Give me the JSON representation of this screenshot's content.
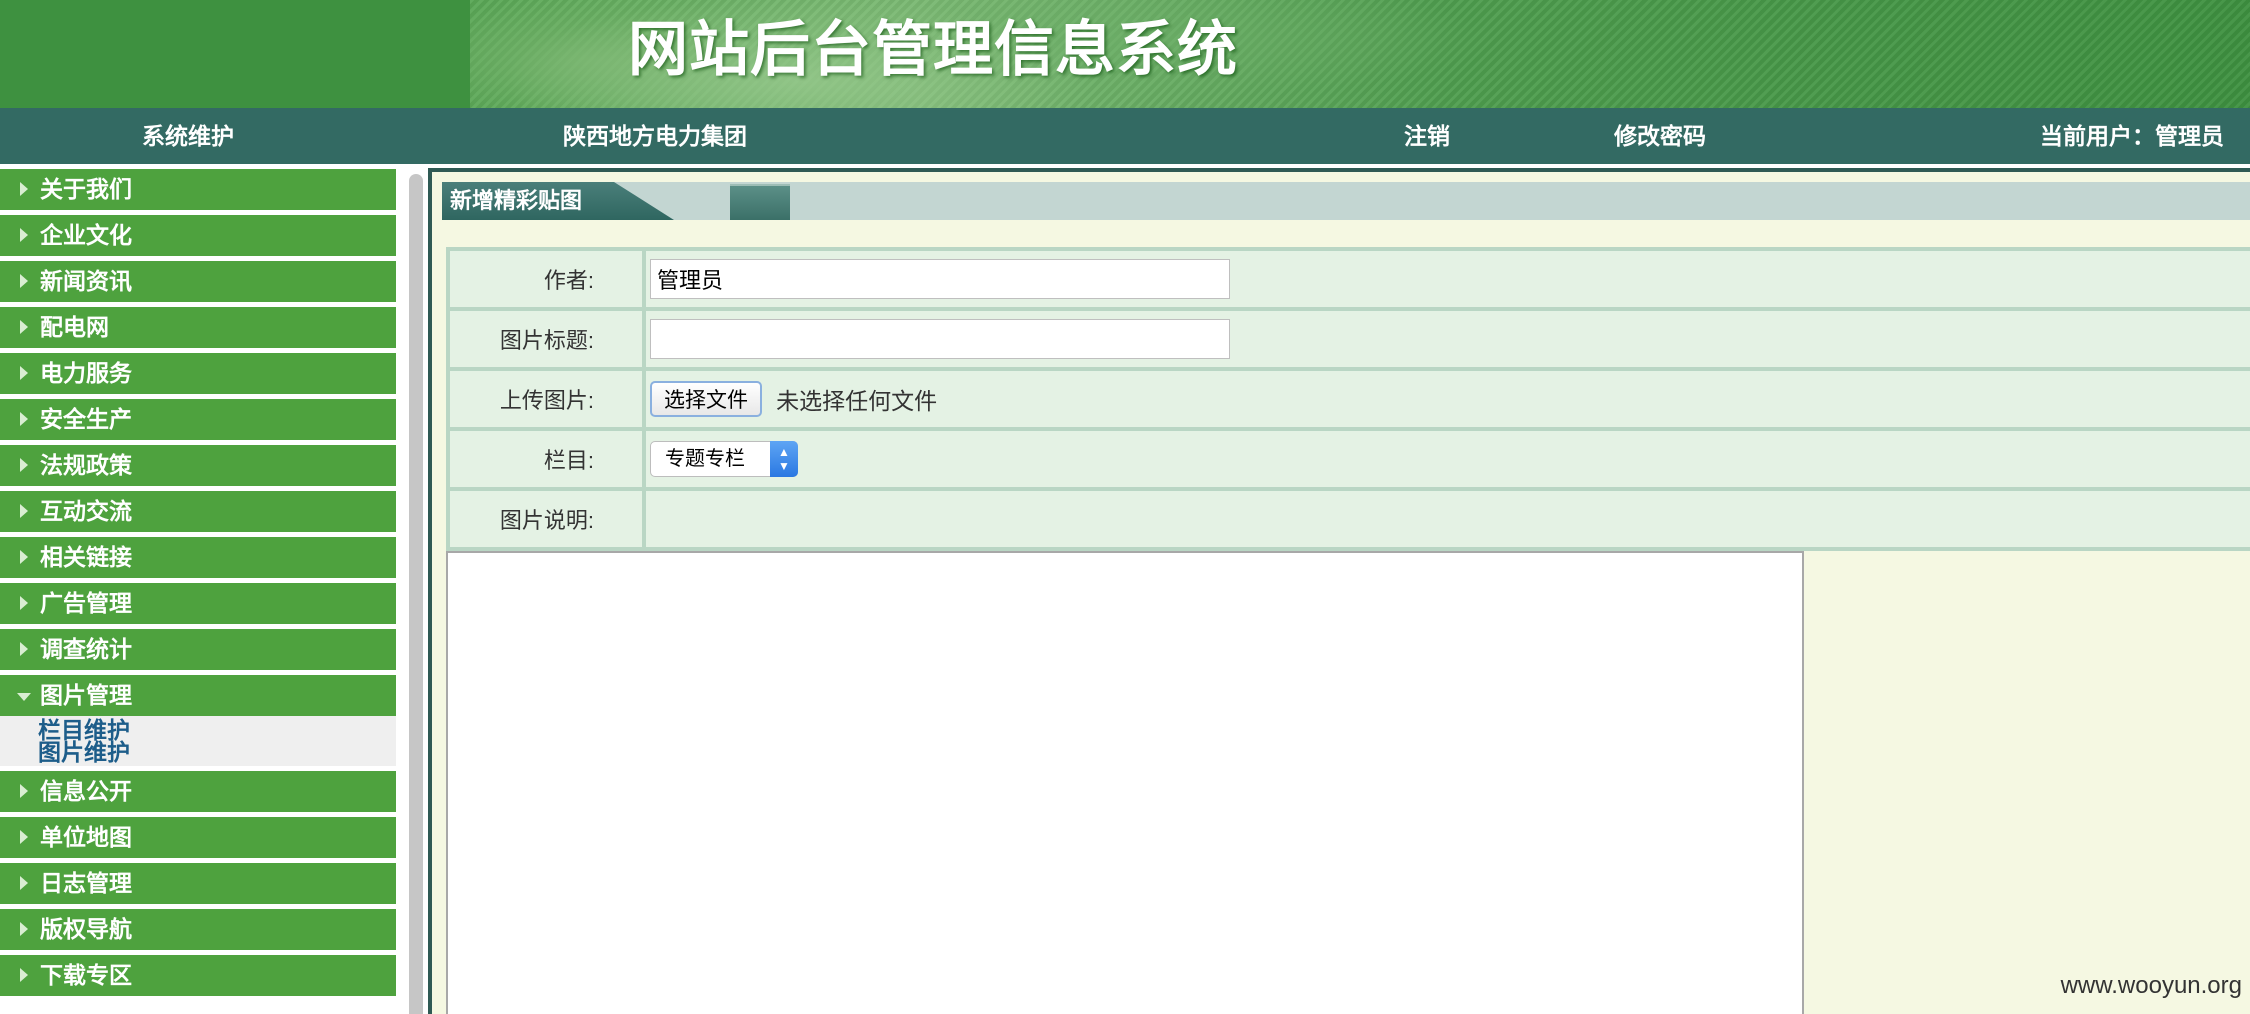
{
  "header": {
    "title": "网站后台管理信息系统"
  },
  "topnav": {
    "system": "系统维护",
    "organization": "陕西地方电力集团",
    "logout": "注销",
    "change_password": "修改密码",
    "current_user": "当前用户：管理员"
  },
  "sidebar": {
    "items": [
      {
        "label": "关于我们"
      },
      {
        "label": "企业文化"
      },
      {
        "label": "新闻资讯"
      },
      {
        "label": "配电网"
      },
      {
        "label": "电力服务"
      },
      {
        "label": "安全生产"
      },
      {
        "label": "法规政策"
      },
      {
        "label": "互动交流"
      },
      {
        "label": "相关链接"
      },
      {
        "label": "广告管理"
      },
      {
        "label": "调查统计"
      },
      {
        "label": "图片管理",
        "expanded": true
      },
      {
        "label": "信息公开"
      },
      {
        "label": "单位地图"
      },
      {
        "label": "日志管理"
      },
      {
        "label": "版权导航"
      },
      {
        "label": "下载专区"
      }
    ],
    "submenu": [
      {
        "label": "栏目维护"
      },
      {
        "label": "图片维护"
      }
    ]
  },
  "panel": {
    "title": "新增精彩贴图"
  },
  "form": {
    "author_label": "作者:",
    "author_value": "管理员",
    "title_label": "图片标题:",
    "title_value": "",
    "upload_label": "上传图片:",
    "upload_button": "选择文件",
    "upload_status": "未选择任何文件",
    "column_label": "栏目:",
    "column_value": "专题专栏",
    "description_label": "图片说明:"
  },
  "watermark": "www.wooyun.org",
  "colors": {
    "banner": "#3e9140",
    "topnav": "#336a63",
    "menu": "#4ea23e",
    "panel_bg": "#f5f8e2",
    "row_bg": "#e4f2e4",
    "submenu_link": "#1d5d8a"
  }
}
